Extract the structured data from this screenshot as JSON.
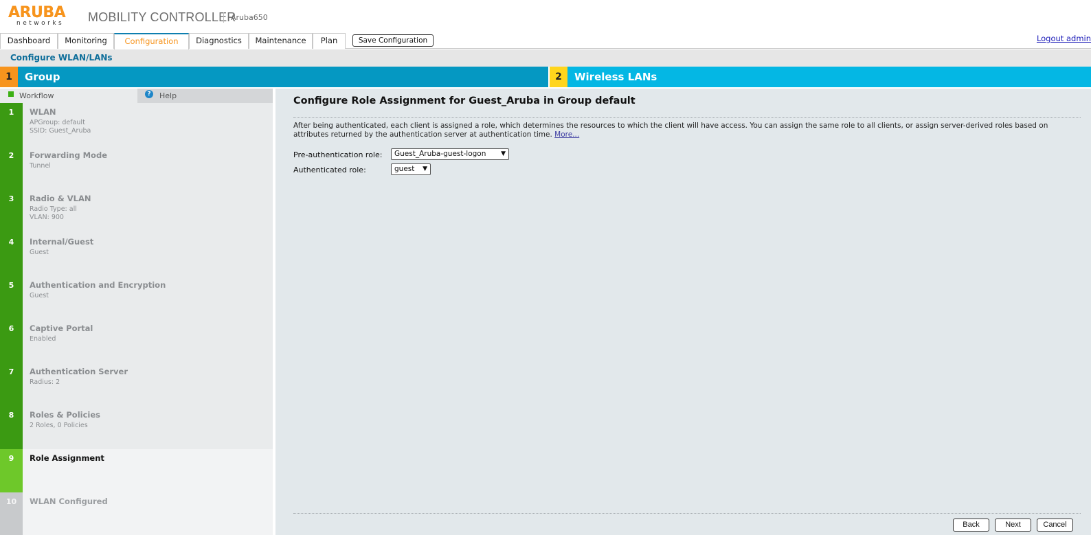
{
  "header": {
    "logo_main": "ARUBA",
    "logo_sub": "networks",
    "product": "MOBILITY CONTROLLER",
    "device": "Aruba650"
  },
  "nav": {
    "tabs": [
      {
        "label": "Dashboard"
      },
      {
        "label": "Monitoring"
      },
      {
        "label": "Configuration",
        "active": true
      },
      {
        "label": "Diagnostics"
      },
      {
        "label": "Maintenance"
      },
      {
        "label": "Plan"
      }
    ],
    "save_label": "Save Configuration",
    "logout_label": "Logout admin"
  },
  "page": {
    "title": "Configure WLAN/LANs"
  },
  "steps": [
    {
      "num": "1",
      "label": "Group"
    },
    {
      "num": "2",
      "label": "Wireless LANs"
    }
  ],
  "sidebar": {
    "workflow_tab": "Workflow",
    "help_tab": "Help",
    "help_glyph": "?",
    "items": [
      {
        "num": "1",
        "title": "WLAN",
        "lines": [
          "APGroup: default",
          "SSID: Guest_Aruba"
        ]
      },
      {
        "num": "2",
        "title": "Forwarding Mode",
        "lines": [
          "Tunnel",
          ""
        ]
      },
      {
        "num": "3",
        "title": "Radio & VLAN",
        "lines": [
          "Radio Type: all",
          "VLAN: 900"
        ]
      },
      {
        "num": "4",
        "title": "Internal/Guest",
        "lines": [
          "Guest",
          ""
        ]
      },
      {
        "num": "5",
        "title": "Authentication and Encryption",
        "lines": [
          "Guest",
          ""
        ]
      },
      {
        "num": "6",
        "title": "Captive Portal",
        "lines": [
          "Enabled",
          ""
        ]
      },
      {
        "num": "7",
        "title": "Authentication Server",
        "lines": [
          "Radius: 2",
          ""
        ]
      },
      {
        "num": "8",
        "title": "Roles & Policies",
        "lines": [
          "2 Roles, 0 Policies",
          ""
        ]
      },
      {
        "num": "9",
        "title": "Role Assignment",
        "lines": [
          "",
          ""
        ]
      },
      {
        "num": "10",
        "title": "WLAN Configured",
        "lines": [
          "",
          ""
        ]
      }
    ]
  },
  "main": {
    "title": "Configure Role Assignment for Guest_Aruba in Group default",
    "description": "After being authenticated, each client is assigned a role, which determines the resources to which the client will have access. You can assign the same role to all clients, or assign server-derived roles based on attributes returned by the authentication server at authentication time.",
    "more_link": "More...",
    "pre_auth_label": "Pre-authentication role:",
    "pre_auth_value": "Guest_Aruba-guest-logon",
    "auth_label": "Authenticated role:",
    "auth_value": "guest",
    "dropdown_glyph": "▼",
    "back_label": "Back",
    "next_label": "Next",
    "cancel_label": "Cancel"
  },
  "colors": {
    "brand_orange": "#f7941d",
    "step1_bg": "#0598c2",
    "step2_bg": "#04b7e4",
    "step2_badge": "#ffd51c",
    "workflow_green": "#3b9a12",
    "current_green": "#6ec82a"
  }
}
